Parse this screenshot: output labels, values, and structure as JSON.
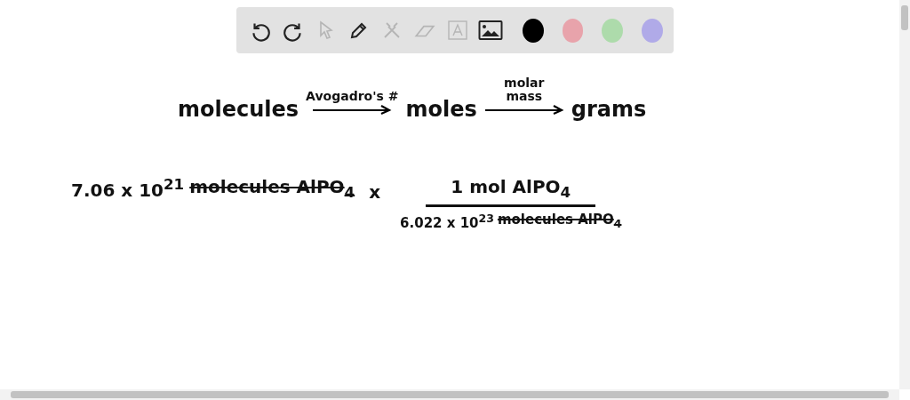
{
  "toolbar": {
    "tools": [
      {
        "kind": "undo",
        "disabled": false
      },
      {
        "kind": "redo",
        "disabled": false
      },
      {
        "kind": "pointer",
        "disabled": true
      },
      {
        "kind": "pen",
        "disabled": false
      },
      {
        "kind": "tools",
        "disabled": true
      },
      {
        "kind": "eraser",
        "disabled": true
      },
      {
        "kind": "text",
        "disabled": true
      },
      {
        "kind": "image",
        "disabled": false
      }
    ],
    "colors": [
      {
        "color": "#000000"
      },
      {
        "color": "#e8a3ab"
      },
      {
        "color": "#addbab"
      },
      {
        "color": "#b0aae8"
      }
    ]
  },
  "canvas": {
    "flow": {
      "steps": [
        "molecules",
        "moles",
        "grams"
      ],
      "arrows": [
        [
          "Avogadro's #"
        ],
        [
          "molar",
          "mass"
        ]
      ]
    },
    "calculation": {
      "start": {
        "amount": "7.06 x 10$^{21}$",
        "unit": "molecules AlPO$_{4}$",
        "cancelled": true
      },
      "operator": "x",
      "numerator": "1 mol AlPO$_{4}$",
      "denominator": {
        "amount": "6.022 x 10$^{23}$",
        "unit": "molecules AlPO$_{4}$",
        "cancelled": true
      }
    }
  }
}
